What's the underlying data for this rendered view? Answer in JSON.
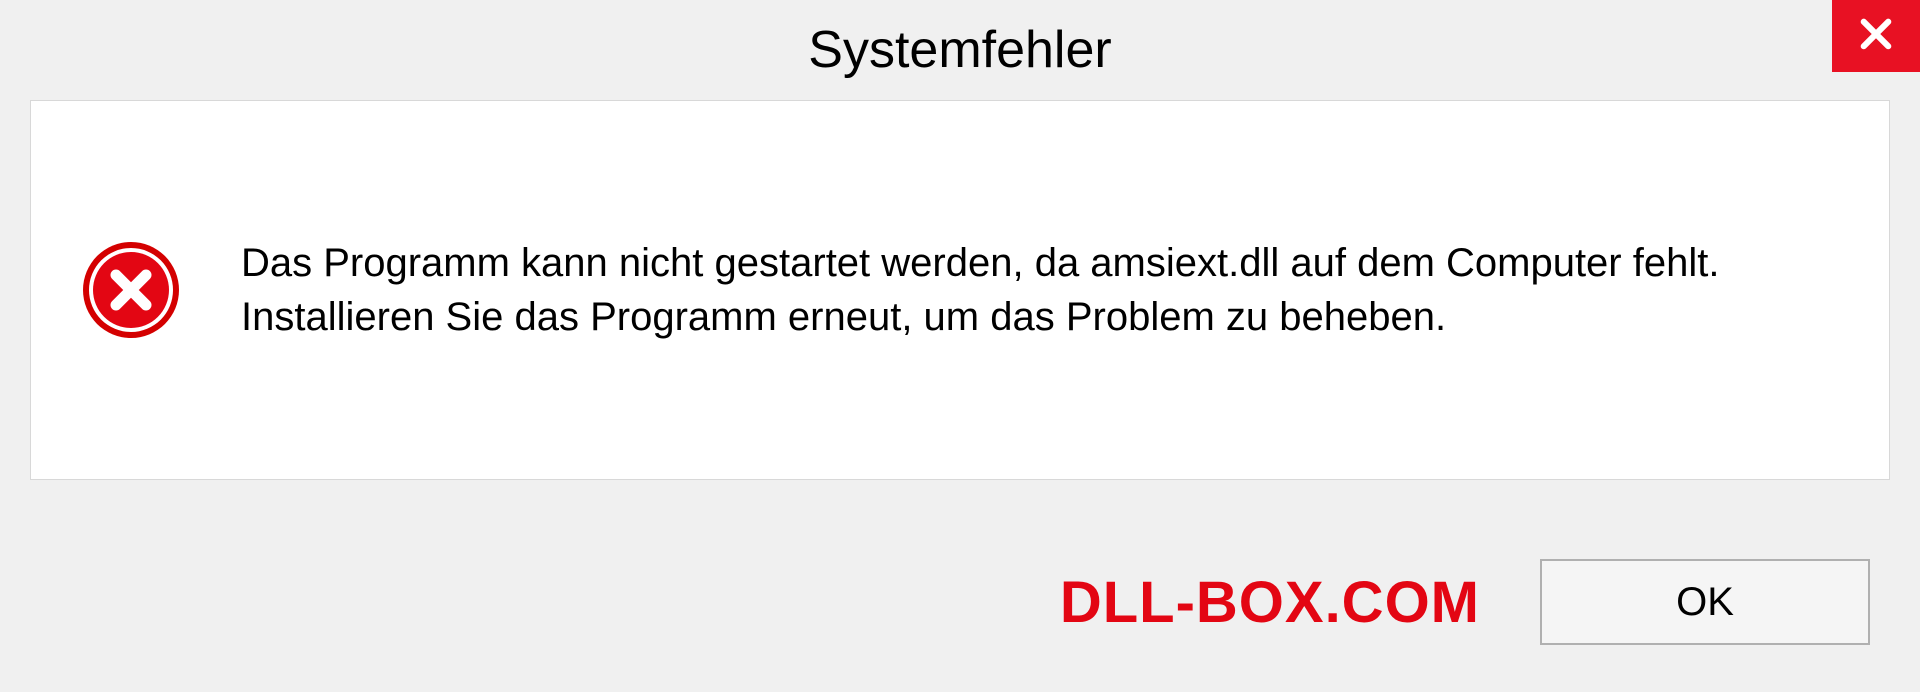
{
  "dialog": {
    "title": "Systemfehler",
    "message": "Das Programm kann nicht gestartet werden, da amsiext.dll auf dem Computer fehlt. Installieren Sie das Programm erneut, um das Problem zu beheben.",
    "ok_label": "OK"
  },
  "watermark": "DLL-BOX.COM"
}
